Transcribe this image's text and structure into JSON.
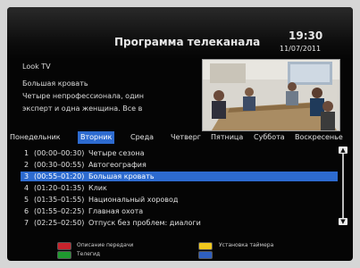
{
  "header": {
    "title": "Программа телеканала",
    "time": "19:30",
    "date": "11/07/2011"
  },
  "channel": {
    "name": "Look TV",
    "description_lines": [
      "Большая кровать",
      "Четыре непрофессионала, один",
      "эксперт и одна женщина. Все в"
    ]
  },
  "days": {
    "items": [
      "Понедельник",
      "Вторник",
      "Среда",
      "Четверг",
      "Пятница",
      "Суббота",
      "Воскресенье"
    ],
    "selected": "Вторник"
  },
  "programs": [
    {
      "num": "1",
      "time": "(00:00–00:30)",
      "name": "Четыре сезона"
    },
    {
      "num": "2",
      "time": "(00:30–00:55)",
      "name": "Автогеография"
    },
    {
      "num": "3",
      "time": "(00:55–01:20)",
      "name": "Большая кровать"
    },
    {
      "num": "4",
      "time": "(01:20–01:35)",
      "name": "Клик"
    },
    {
      "num": "5",
      "time": "(01:35–01:55)",
      "name": "Национальный хоровод"
    },
    {
      "num": "6",
      "time": "(01:55–02:25)",
      "name": "Главная охота"
    },
    {
      "num": "7",
      "time": "(02:25–02:50)",
      "name": "Отпуск без проблем: диалоги"
    }
  ],
  "selected_program_index": 2,
  "footer": {
    "red_label": "Описание передачи",
    "green_label": "Телегид",
    "yellow_label": "Установка таймера",
    "colors": {
      "red": "#c8232c",
      "green": "#1f9a2f",
      "yellow": "#f0c81e",
      "blue": "#2f5fc0"
    }
  },
  "colors": {
    "highlight": "#2d6bd0",
    "background": "#050505"
  }
}
